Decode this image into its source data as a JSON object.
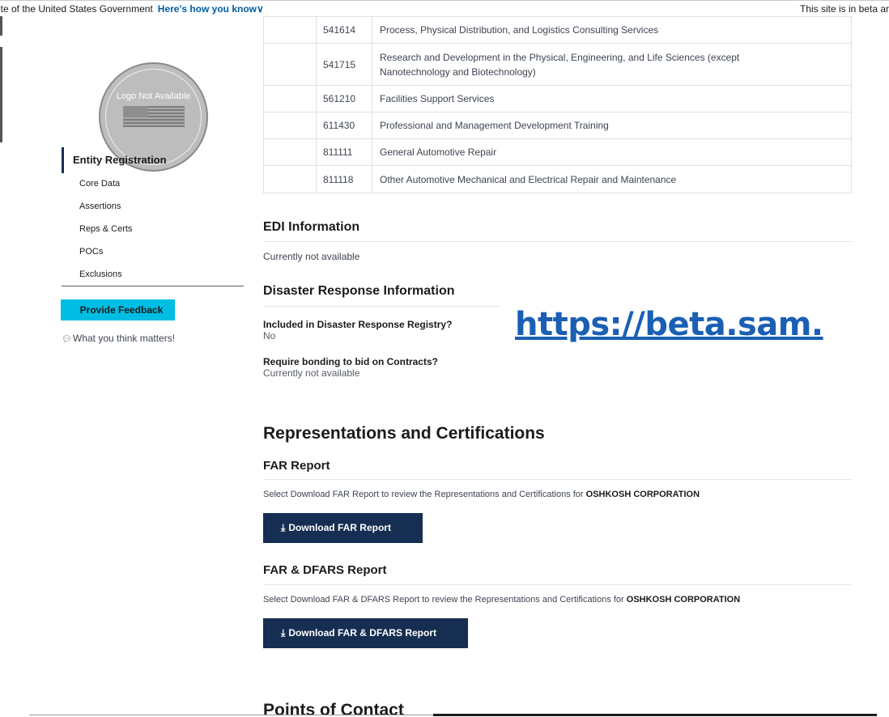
{
  "banner": {
    "gov_text": "ite of the United States Government",
    "how_text": "Here's how you know",
    "how_chevron": "∨",
    "beta_text": "This site is in beta ar"
  },
  "sidebar": {
    "logo_text": "Logo Not Available",
    "nav_title": "Entity Registration",
    "items": [
      "Core Data",
      "Assertions",
      "Reps & Certs",
      "POCs",
      "Exclusions"
    ],
    "feedback_button": "Provide Feedback",
    "feedback_note": "What you think matters!",
    "feedback_icon": "comments-icon"
  },
  "naics": [
    {
      "code": "541614",
      "description": "Process, Physical Distribution, and Logistics Consulting Services"
    },
    {
      "code": "541715",
      "description": "Research and Development in the Physical, Engineering, and Life Sciences (except Nanotechnology and Biotechnology)"
    },
    {
      "code": "561210",
      "description": "Facilities Support Services"
    },
    {
      "code": "611430",
      "description": "Professional and Management Development Training"
    },
    {
      "code": "811111",
      "description": "General Automotive Repair"
    },
    {
      "code": "811118",
      "description": "Other Automotive Mechanical and Electrical Repair and Maintenance"
    }
  ],
  "edi": {
    "title": "EDI Information",
    "value": "Currently not available"
  },
  "disaster": {
    "title": "Disaster Response Information",
    "q1_label": "Included in Disaster Response Registry?",
    "q1_value": "No",
    "q2_label": "Require bonding to bid on Contracts?",
    "q2_value": "Currently not available"
  },
  "overlay_link": "https://beta.sam.",
  "reps": {
    "title": "Representations and Certifications",
    "far": {
      "title": "FAR Report",
      "desc_prefix": "Select Download FAR Report to review the Representations and Certifications for",
      "entity": "OSHKOSH CORPORATION",
      "button": "Download FAR Report"
    },
    "far_dfars": {
      "title": "FAR & DFARS Report",
      "desc_prefix": "Select Download FAR & DFARS Report to review the Representations and Certifications for",
      "entity": "OSHKOSH CORPORATION",
      "button": "Download FAR & DFARS Report"
    },
    "download_icon": "download-icon"
  },
  "poc": {
    "title": "Points of Contact"
  },
  "colors": {
    "primary_dark": "#162e51",
    "feedback_cyan": "#00bde3",
    "link_blue": "#005ea2",
    "overlay_link_blue": "#1a5fb4"
  }
}
